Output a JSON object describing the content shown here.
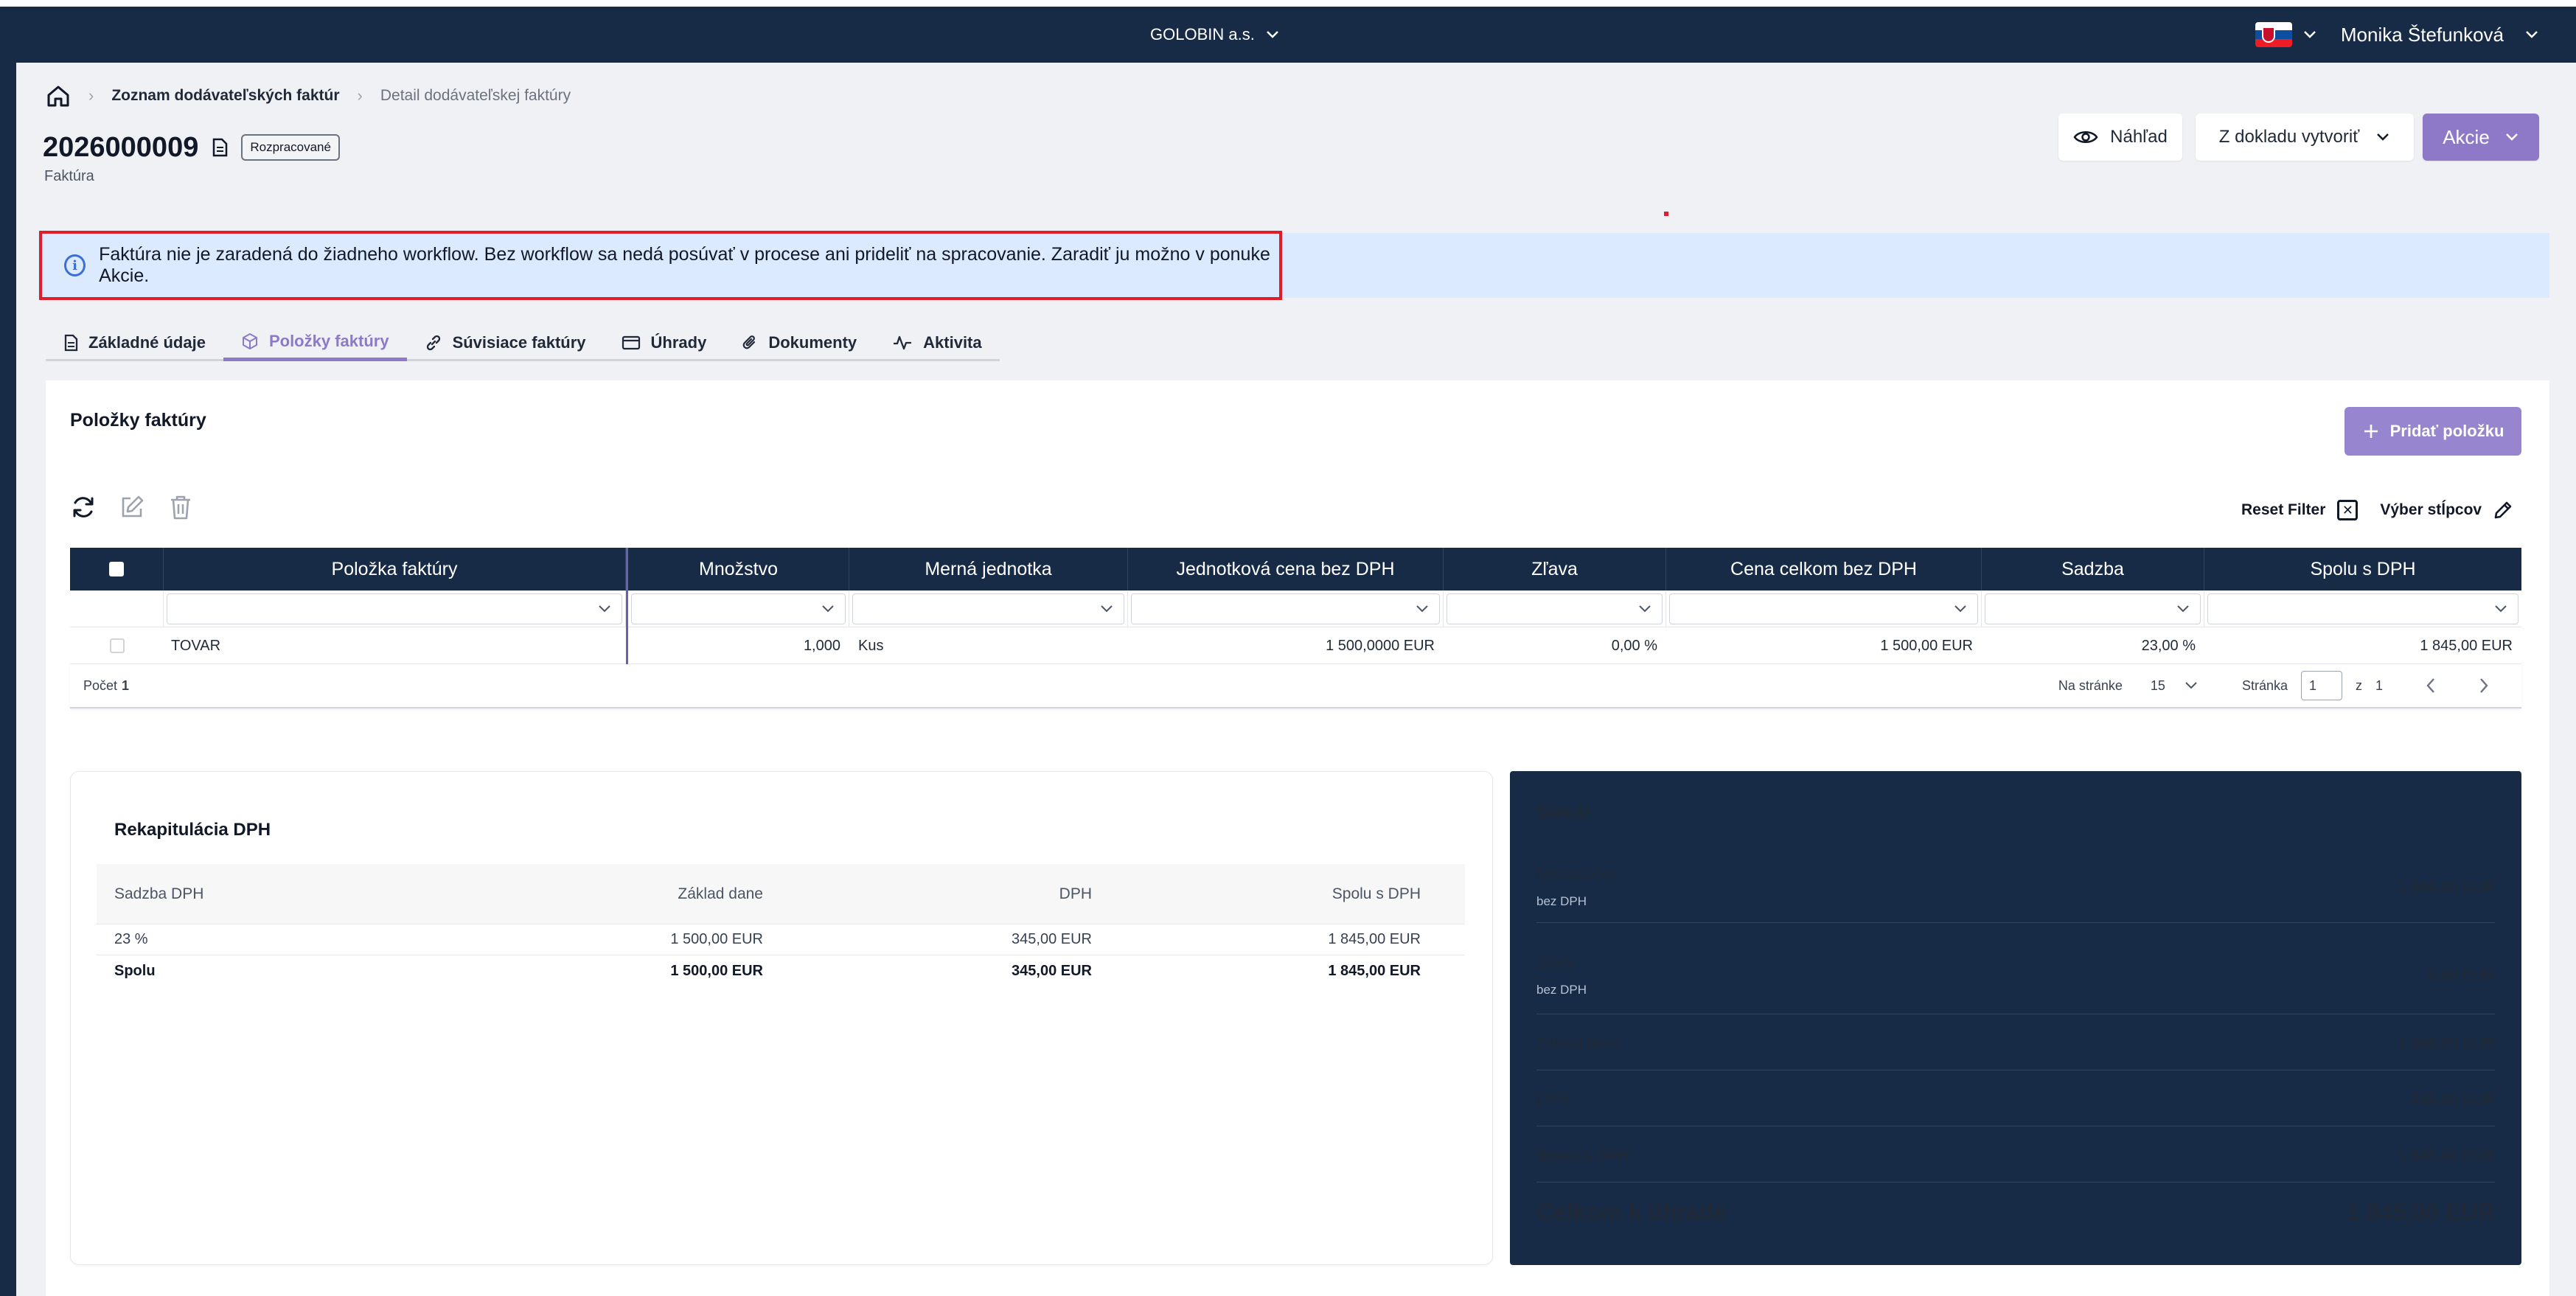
{
  "topbar": {
    "company": "GOLOBIN a.s.",
    "user": "Monika Štefunková",
    "flag_colors": [
      "#ffffff",
      "#0b4ea2",
      "#ee1c25"
    ]
  },
  "breadcrumb": {
    "home_icon": "home-icon",
    "list": "Zoznam dodávateľských faktúr",
    "current": "Detail dodávateľskej faktúry"
  },
  "document": {
    "number": "2026000009",
    "status": "Rozpracované",
    "type": "Faktúra"
  },
  "header_actions": {
    "preview": "Náhľad",
    "create_from": "Z dokladu vytvoriť",
    "actions": "Akcie"
  },
  "alert": {
    "text": "Faktúra nie je zaradená do žiadneho workflow. Bez workflow sa nedá posúvať v procese ani prideliť na spracovanie. Zaradiť ju možno v ponuke Akcie."
  },
  "tabs": [
    {
      "label": "Základné údaje",
      "icon": "document-icon"
    },
    {
      "label": "Položky faktúry",
      "icon": "box-icon",
      "active": true
    },
    {
      "label": "Súvisiace faktúry",
      "icon": "link-icon"
    },
    {
      "label": "Úhrady",
      "icon": "card-icon"
    },
    {
      "label": "Dokumenty",
      "icon": "paperclip-icon"
    },
    {
      "label": "Aktivita",
      "icon": "activity-icon"
    }
  ],
  "items_panel": {
    "title": "Položky faktúry",
    "add_button": "Pridať položku",
    "reset_filter": "Reset Filter",
    "columns_select": "Výber stĺpcov"
  },
  "grid": {
    "columns": [
      "Položka faktúry",
      "Množstvo",
      "Merná jednotka",
      "Jednotková cena bez DPH",
      "Zľava",
      "Cena celkom bez DPH",
      "Sadzba",
      "Spolu s DPH"
    ],
    "rows": [
      [
        "TOVAR",
        "1,000",
        "Kus",
        "1 500,0000 EUR",
        "0,00 %",
        "1 500,00 EUR",
        "23,00 %",
        "1 845,00 EUR"
      ]
    ],
    "footer": {
      "count_label": "Počet",
      "count": "1",
      "per_page_label": "Na stránke",
      "per_page": "15",
      "page_label": "Stránka",
      "page": "1",
      "of_label": "z",
      "total_pages": "1"
    }
  },
  "recap": {
    "title": "Rekapitulácia DPH",
    "headers": [
      "Sadzba DPH",
      "Základ dane",
      "DPH",
      "Spolu s DPH"
    ],
    "rows": [
      [
        "23 %",
        "1 500,00 EUR",
        "345,00 EUR",
        "1 845,00 EUR"
      ]
    ],
    "total": [
      "Spolu",
      "1 500,00 EUR",
      "345,00 EUR",
      "1 845,00 EUR"
    ]
  },
  "summary": {
    "title": "Sumár",
    "subtotal_label": "Medzisúčet",
    "subtotal_sub": "bez DPH",
    "subtotal": "1 500,00 EUR",
    "discounts_label": "Zľavy",
    "discounts_sub": "bez DPH",
    "discounts": "0,00 EUR",
    "tax_base_label": "Základ dane",
    "tax_base": "1 500,00 EUR",
    "vat_label": "DPH",
    "vat": "345,00 EUR",
    "total_vat_label": "Spolu s DPH",
    "total_vat": "1 845,00 EUR",
    "to_pay_label": "Celkom k úhrade",
    "to_pay": "1 845,00 EUR"
  }
}
